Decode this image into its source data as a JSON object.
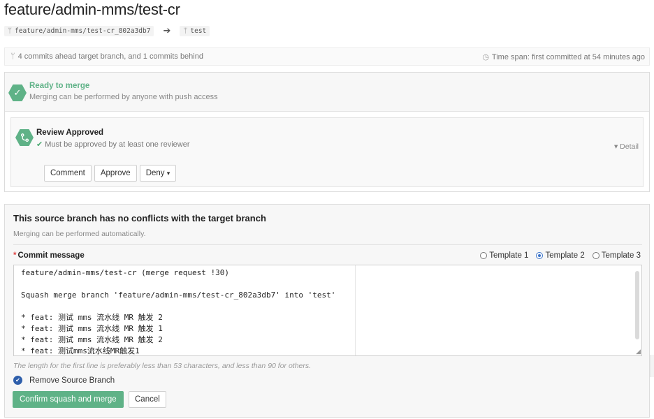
{
  "page": {
    "title": "feature/admin-mms/test-cr"
  },
  "branches": {
    "source": "feature/admin-mms/test-cr_802a3db7",
    "target": "test",
    "branch_icon": "branch-icon",
    "arrow_icon": "arrow-right-icon"
  },
  "info": {
    "commits_text": "4 commits ahead target branch, and 1 commits behind",
    "timespan_text": "Time span: first committed at 54 minutes ago",
    "clock_icon": "clock-icon"
  },
  "status": {
    "ready_title": "Ready to merge",
    "ready_sub": "Merging can be performed by anyone with push access",
    "ready_icon": "check-icon",
    "accent_color": "#5fb287"
  },
  "review": {
    "title": "Review Approved",
    "requirement": "Must be approved by at least one reviewer",
    "detail_label": "Detail",
    "buttons": {
      "comment": "Comment",
      "approve": "Approve",
      "deny": "Deny"
    },
    "review_icon": "git-merge-icon"
  },
  "confirm": {
    "title": "This source branch has no conflicts with the target branch",
    "subtitle": "Merging can be performed automatically.",
    "commit_message_label": "Commit message",
    "required_mark": "*",
    "templates": [
      "Template 1",
      "Template 2",
      "Template 3"
    ],
    "selected_template": "Template 2",
    "commit_message": "feature/admin-mms/test-cr (merge request !30)\n\nSquash merge branch 'feature/admin-mms/test-cr_802a3db7' into 'test'\n\n* feat: 测试 mms 流水线 MR 触发 2\n* feat: 测试 mms 流水线 MR 触发 1\n* feat: 测试 mms 流水线 MR 触发 2\n* feat: 测试mms流水线MR触发1",
    "hint": "The length for the first line is preferably less than 53 characters, and less than 90 for others.",
    "remove_source_label": "Remove Source Branch",
    "remove_source_checked": true,
    "confirm_button": "Confirm squash and merge",
    "cancel_button": "Cancel"
  }
}
